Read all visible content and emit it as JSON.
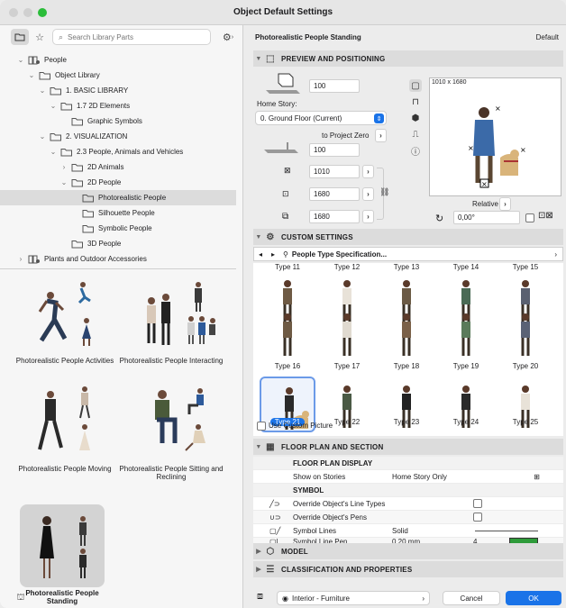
{
  "window": {
    "title": "Object Default Settings"
  },
  "colors": {
    "accent": "#1a73e8",
    "close": "#d0d0d0",
    "minimize": "#d0d0d0",
    "zoom": "#2bbd3a"
  },
  "left": {
    "search_placeholder": "Search Library Parts",
    "tree": [
      {
        "label": "People",
        "level": 0,
        "chev": "down",
        "icon": "people-library"
      },
      {
        "label": "Object Library",
        "level": 1,
        "chev": "down",
        "icon": "folder"
      },
      {
        "label": "1. BASIC LIBRARY",
        "level": 2,
        "chev": "down",
        "icon": "folder"
      },
      {
        "label": "1.7 2D Elements",
        "level": 3,
        "chev": "down",
        "icon": "folder"
      },
      {
        "label": "Graphic Symbols",
        "level": 4,
        "chev": "",
        "icon": "folder"
      },
      {
        "label": "2. VISUALIZATION",
        "level": 2,
        "chev": "down",
        "icon": "folder"
      },
      {
        "label": "2.3 People, Animals and Vehicles",
        "level": 3,
        "chev": "down",
        "icon": "folder"
      },
      {
        "label": "2D Animals",
        "level": 4,
        "chev": "right",
        "icon": "folder"
      },
      {
        "label": "2D People",
        "level": 4,
        "chev": "down",
        "icon": "folder"
      },
      {
        "label": "Photorealistic People",
        "level": 5,
        "chev": "",
        "icon": "folder",
        "selected": true
      },
      {
        "label": "Silhouette People",
        "level": 5,
        "chev": "",
        "icon": "folder"
      },
      {
        "label": "Symbolic People",
        "level": 5,
        "chev": "",
        "icon": "folder"
      },
      {
        "label": "3D People",
        "level": 4,
        "chev": "",
        "icon": "folder"
      },
      {
        "label": "Plants and Outdoor Accessories",
        "level": 0,
        "chev": "right",
        "icon": "people-library"
      }
    ],
    "thumbs": [
      {
        "label": "Photorealistic People Activities"
      },
      {
        "label": "Photorealistic People Interacting"
      },
      {
        "label": "Photorealistic People Moving"
      },
      {
        "label": "Photorealistic People Sitting and Reclining"
      },
      {
        "label": "Photorealistic People Standing",
        "selected": true
      }
    ]
  },
  "right": {
    "header_title": "Photorealistic People Standing",
    "header_default": "Default",
    "preview": {
      "section": "PREVIEW AND POSITIONING",
      "elevation": "100",
      "home_story_label": "Home Story:",
      "home_story": "0. Ground Floor (Current)",
      "to_project_zero": "to Project Zero",
      "offset": "100",
      "width": "1010",
      "depth": "1680",
      "height": "1680",
      "preview_size": "1010 x 1680",
      "relative": "Relative",
      "angle": "0,00°"
    },
    "custom": {
      "section": "CUSTOM SETTINGS",
      "selector": "People Type Specification...",
      "types": [
        "Type 11",
        "Type 12",
        "Type 13",
        "Type 14",
        "Type 15",
        "Type 16",
        "Type 17",
        "Type 18",
        "Type 19",
        "Type 20",
        "Type 21",
        "Type 22",
        "Type 23",
        "Type 24",
        "Type 25"
      ],
      "selected": "Type 21",
      "use_custom_picture": "Use Custom Picture"
    },
    "floorplan": {
      "section": "FLOOR PLAN AND SECTION",
      "display_header": "FLOOR PLAN DISPLAY",
      "show_on_stories": "Show on Stories",
      "show_value": "Home Story Only",
      "symbol_header": "SYMBOL",
      "override_line_types": "Override Object's Line Types",
      "override_pens": "Override Object's Pens",
      "symbol_lines": "Symbol Lines",
      "symbol_lines_value": "Solid",
      "symbol_line_pen": "Symbol Line Pen",
      "symbol_line_pen_value": "0.20 mm",
      "symbol_line_pen_number": "4"
    },
    "model_section": "MODEL",
    "classification_section": "CLASSIFICATION AND PROPERTIES",
    "footer": {
      "layer": "Interior - Furniture",
      "cancel": "Cancel",
      "ok": "OK"
    }
  }
}
